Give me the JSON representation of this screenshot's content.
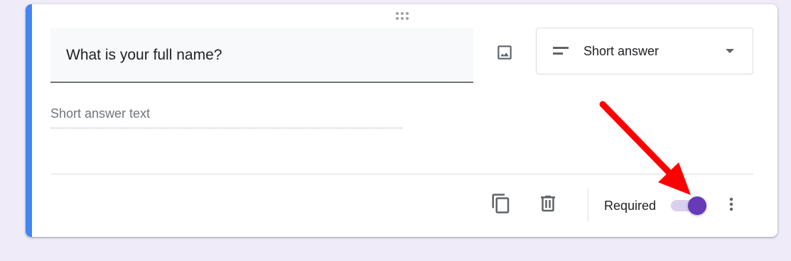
{
  "question": {
    "title": "What is your full name?",
    "answer_placeholder": "Short answer text"
  },
  "question_type": {
    "label": "Short answer",
    "icon": "short-text-icon"
  },
  "footer": {
    "required_label": "Required",
    "required_on": true
  },
  "icons": {
    "drag": "drag-handle-icon",
    "image": "image-icon",
    "duplicate": "copy-icon",
    "delete": "trash-icon",
    "more": "more-vert-icon",
    "dropdown": "chevron-down-icon"
  },
  "colors": {
    "accent_bar": "#4285f4",
    "toggle_thumb": "#673ab7",
    "toggle_track": "#d9cff0",
    "annotation_arrow": "#ff0000",
    "page_background": "#efebf8"
  }
}
